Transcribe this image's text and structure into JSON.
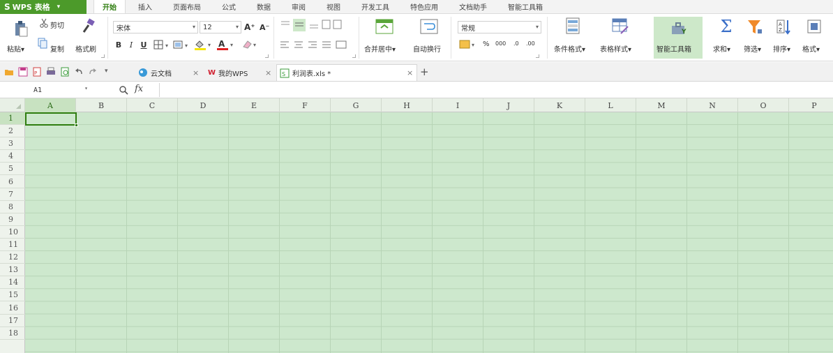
{
  "app": {
    "name": "WPS 表格",
    "caret": "▾"
  },
  "menu_tabs": [
    "开始",
    "插入",
    "页面布局",
    "公式",
    "数据",
    "审阅",
    "视图",
    "开发工具",
    "特色应用",
    "文档助手",
    "智能工具箱"
  ],
  "active_menu_tab": "开始",
  "ribbon": {
    "paste": "粘贴",
    "cut": "剪切",
    "copy": "复制",
    "format_painter": "格式刷",
    "font_name": "宋体",
    "font_size": "12",
    "bold": "B",
    "italic": "I",
    "underline": "U",
    "grow_font": "A⁺",
    "shrink_font": "A⁻",
    "merge_center": "合并居中",
    "wrap_text": "自动换行",
    "number_format": "常规",
    "percent": "%",
    "thousands": "000",
    "inc_decimal": ".0",
    "dec_decimal": ".00",
    "conditional_format": "条件格式",
    "table_style": "表格样式",
    "smart_toolbox": "智能工具箱",
    "sum": "求和",
    "filter": "筛选",
    "sort": "排序",
    "format": "格式",
    "dropdown": "▾"
  },
  "doc_tabs": [
    {
      "label": "云文档",
      "close": "×"
    },
    {
      "label": "我的WPS",
      "close": "×"
    },
    {
      "label": "利润表.xls *",
      "close": "×"
    }
  ],
  "new_tab": "+",
  "formula_bar": {
    "cell_ref": "A1",
    "fx": "fx",
    "value": ""
  },
  "columns": [
    "A",
    "B",
    "C",
    "D",
    "E",
    "F",
    "G",
    "H",
    "I",
    "J",
    "K",
    "L",
    "M",
    "N",
    "O",
    "P"
  ],
  "rows": [
    "1",
    "2",
    "3",
    "4",
    "5",
    "6",
    "7",
    "8",
    "9",
    "10",
    "11",
    "12",
    "13",
    "14",
    "15",
    "16",
    "17",
    "18"
  ],
  "selected_cell": "A1",
  "colors": {
    "accent": "#4c9a2a",
    "grid_fill": "#cde8cd",
    "selection": "#2f7d10"
  }
}
